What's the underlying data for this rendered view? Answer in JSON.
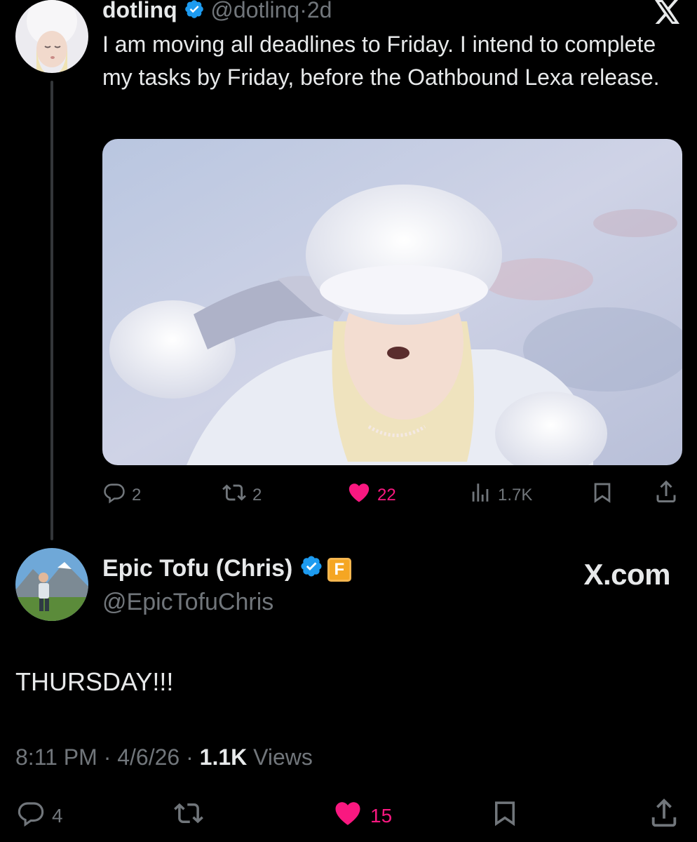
{
  "tweet1": {
    "display_name": "dotlinq",
    "handle": "@dotlinq",
    "time_ago": "2d",
    "separator": "·",
    "text": "I am moving all deadlines to Friday. I intend to complete my tasks by Friday, before the Oathbound Lexa release.",
    "actions": {
      "replies": "2",
      "reposts": "2",
      "likes": "22",
      "views": "1.7K"
    }
  },
  "tweet2": {
    "display_name": "Epic Tofu (Chris)",
    "handle": "@EpicTofuChris",
    "badge_letter": "F",
    "text": "THURSDAY!!!",
    "time": "8:11 PM",
    "date": "4/6/26",
    "separator": "·",
    "views_count": "1.1K",
    "views_label": "Views",
    "actions": {
      "replies": "4",
      "likes": "15"
    }
  },
  "brand_label": "X.com",
  "colors": {
    "background": "#000000",
    "text": "#e7e9ea",
    "muted": "#71767b",
    "like": "#f91880",
    "verified": "#1d9bf0"
  },
  "icons": [
    "x-logo-icon",
    "verified-badge-icon",
    "reply-icon",
    "repost-icon",
    "heart-icon",
    "views-icon",
    "bookmark-icon",
    "share-icon"
  ]
}
